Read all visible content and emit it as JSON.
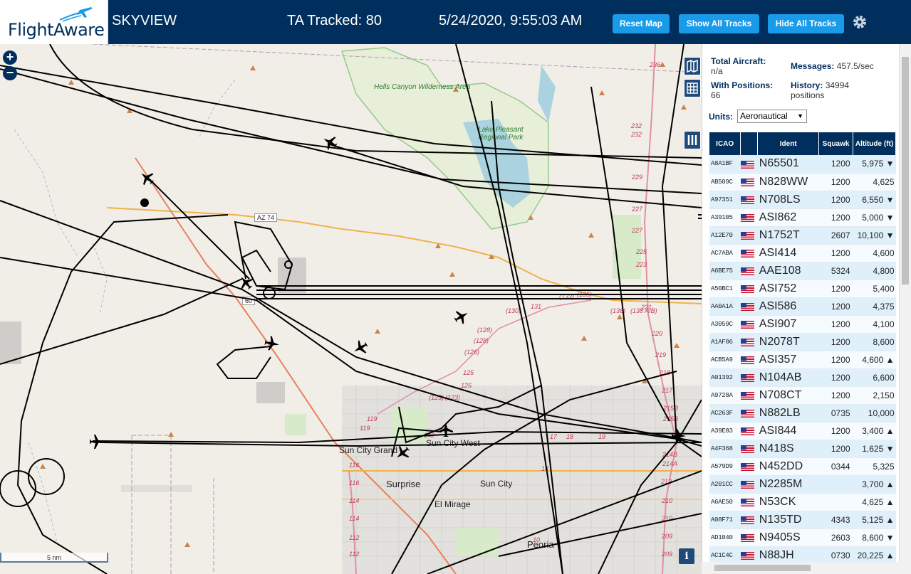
{
  "header": {
    "brand": "FlightAware",
    "title": "SKYVIEW",
    "tracked": "TA Tracked: 80",
    "datetime": "5/24/2020, 9:55:03 AM",
    "buttons": {
      "reset_map": "Reset Map",
      "show_all_tracks": "Show All Tracks",
      "hide_all_tracks": "Hide All Tracks"
    }
  },
  "map": {
    "zoom_in": "+",
    "zoom_out": "−",
    "scale": "5 nm",
    "info": "i",
    "labels": {
      "surprise": "Surprise",
      "sun_city": "Sun City",
      "sun_city_west": "Sun City West",
      "sun_city_grand": "Sun City Grand",
      "el_mirage": "El Mirage",
      "peoria": "Peoria",
      "lake_pleasant": "Lake Pleasant Regional Park",
      "hells_canyon": "Hells Canyon Wilderness Area",
      "az74": "AZ 74",
      "us60": "60"
    }
  },
  "panel": {
    "total_aircraft_label": "Total Aircraft:",
    "total_aircraft": "n/a",
    "with_positions_label": "With Positions:",
    "with_positions": "66",
    "messages_label": "Messages:",
    "messages": "457.5/sec",
    "history_label": "History:",
    "history": "34994 positions",
    "units_label": "Units:",
    "units_value": "Aeronautical",
    "columns": [
      "ICAO",
      "",
      "Ident",
      "Squawk",
      "Altitude (ft)"
    ],
    "rows": [
      {
        "icao": "A8A1BF",
        "ident": "N65501",
        "squawk": "1200",
        "alt": "5,975 ▼"
      },
      {
        "icao": "AB509C",
        "ident": "N828WW",
        "squawk": "1200",
        "alt": "4,625"
      },
      {
        "icao": "A97351",
        "ident": "N708LS",
        "squawk": "1200",
        "alt": "6,550 ▼"
      },
      {
        "icao": "A39105",
        "ident": "ASI862",
        "squawk": "1200",
        "alt": "5,000 ▼"
      },
      {
        "icao": "A12E70",
        "ident": "N1752T",
        "squawk": "2607",
        "alt": "10,100 ▼"
      },
      {
        "icao": "AC7ABA",
        "ident": "ASI414",
        "squawk": "1200",
        "alt": "4,600"
      },
      {
        "icao": "A6BE75",
        "ident": "AAE108",
        "squawk": "5324",
        "alt": "4,800"
      },
      {
        "icao": "A50BC1",
        "ident": "ASI752",
        "squawk": "1200",
        "alt": "5,400"
      },
      {
        "icao": "AA0A1A",
        "ident": "ASI586",
        "squawk": "1200",
        "alt": "4,375"
      },
      {
        "icao": "A3059C",
        "ident": "ASI907",
        "squawk": "1200",
        "alt": "4,100"
      },
      {
        "icao": "A1AF86",
        "ident": "N2078T",
        "squawk": "1200",
        "alt": "8,600"
      },
      {
        "icao": "ACB5A9",
        "ident": "ASI357",
        "squawk": "1200",
        "alt": "4,600 ▲"
      },
      {
        "icao": "A01392",
        "ident": "N104AB",
        "squawk": "1200",
        "alt": "6,600"
      },
      {
        "icao": "A9728A",
        "ident": "N708CT",
        "squawk": "1200",
        "alt": "2,150"
      },
      {
        "icao": "AC263F",
        "ident": "N882LB",
        "squawk": "0735",
        "alt": "10,000"
      },
      {
        "icao": "A39E83",
        "ident": "ASI844",
        "squawk": "1200",
        "alt": "3,400 ▲"
      },
      {
        "icao": "A4F368",
        "ident": "N418S",
        "squawk": "1200",
        "alt": "1,625 ▼"
      },
      {
        "icao": "A579D9",
        "ident": "N452DD",
        "squawk": "0344",
        "alt": "5,325"
      },
      {
        "icao": "A201CC",
        "ident": "N2285M",
        "squawk": "",
        "alt": "3,700 ▲"
      },
      {
        "icao": "A6AE50",
        "ident": "N53CK",
        "squawk": "",
        "alt": "4,625 ▲"
      },
      {
        "icao": "A08F71",
        "ident": "N135TD",
        "squawk": "4343",
        "alt": "5,125 ▲"
      },
      {
        "icao": "AD1040",
        "ident": "N9405S",
        "squawk": "2603",
        "alt": "8,600 ▼"
      },
      {
        "icao": "AC1C4C",
        "ident": "N88JH",
        "squawk": "0730",
        "alt": "20,225 ▲"
      }
    ]
  },
  "colors": {
    "header_bg": "#002f5d",
    "button": "#1a9bea",
    "track": "#000000",
    "row_bg": "#dff0fb"
  }
}
